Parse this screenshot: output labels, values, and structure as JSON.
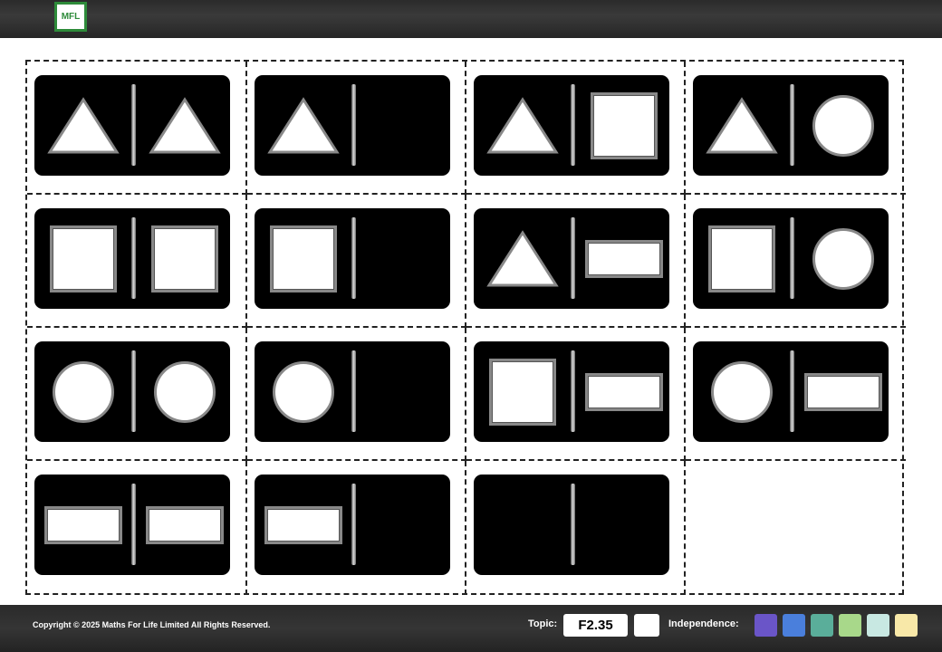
{
  "header": {
    "logo_text": "MFL"
  },
  "dominoes": [
    {
      "left": "triangle",
      "right": "triangle"
    },
    {
      "left": "triangle",
      "right": "blank"
    },
    {
      "left": "triangle",
      "right": "square"
    },
    {
      "left": "triangle",
      "right": "circle"
    },
    {
      "left": "square",
      "right": "square"
    },
    {
      "left": "square",
      "right": "blank"
    },
    {
      "left": "triangle",
      "right": "rectangle"
    },
    {
      "left": "square",
      "right": "circle"
    },
    {
      "left": "circle",
      "right": "circle"
    },
    {
      "left": "circle",
      "right": "blank"
    },
    {
      "left": "square",
      "right": "rectangle"
    },
    {
      "left": "circle",
      "right": "rectangle"
    },
    {
      "left": "rectangle",
      "right": "rectangle"
    },
    {
      "left": "rectangle",
      "right": "blank"
    },
    {
      "left": "blank",
      "right": "blank"
    },
    null
  ],
  "footer": {
    "copyright": "Copyright © 2025 Maths For Life Limited All Rights Reserved.",
    "topic_label": "Topic:",
    "topic_code": "F2.35",
    "independence_label": "Independence:",
    "independence_colors": [
      "#6a55c8",
      "#4a7fdc",
      "#5aae9a",
      "#a8d88a",
      "#c8e8e2",
      "#f8e8a8"
    ]
  }
}
